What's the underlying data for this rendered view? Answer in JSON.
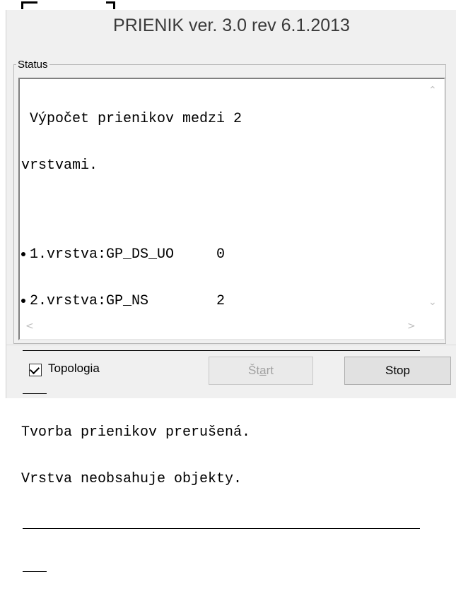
{
  "dialog": {
    "title": "PRIENIK ver. 3.0 rev 6.1.2013"
  },
  "status_group": {
    "legend": "Status",
    "log_lines": [
      " Výpočet prienikov medzi 2",
      "vrstvami.",
      "1.vrstva:GP_DS_UO     0",
      "2.vrstva:GP_NS        2",
      "Tvorba prienikov prerušená.",
      "Vrstva neobsahuje objekty."
    ]
  },
  "icons": {
    "scroll_up": "chevron-up-icon",
    "scroll_down": "chevron-down-icon",
    "scroll_left": "chevron-left-icon",
    "scroll_right": "chevron-right-icon",
    "bullet": "bullet-icon",
    "check": "checkmark-icon"
  },
  "options": {
    "topologia_label": "Topologia",
    "topologia_checked": true
  },
  "buttons": {
    "start_label": "Štart",
    "start_enabled": false,
    "stop_label": "Stop"
  }
}
